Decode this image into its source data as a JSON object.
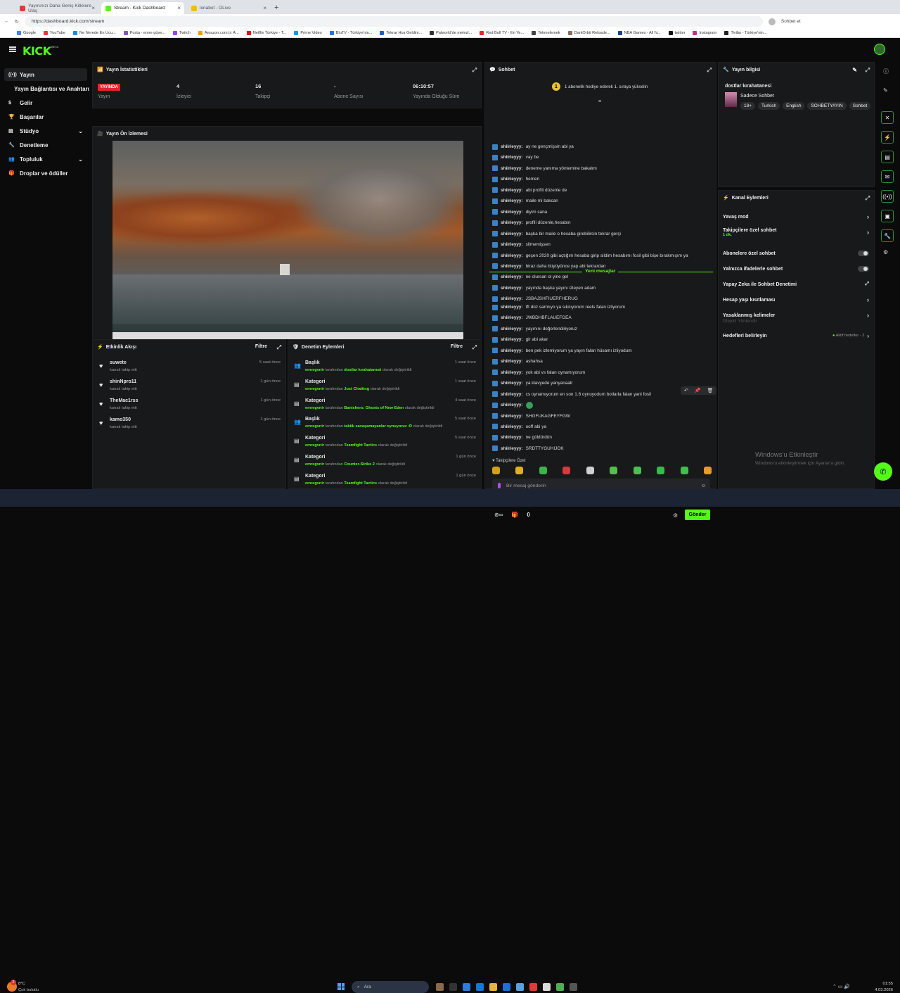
{
  "browser": {
    "tabs": [
      {
        "label": "Yayınınızı Daha Geniş Kitlelere Ulaş",
        "color": "#e53935"
      },
      {
        "label": "Stream - Kick Dashboard",
        "color": "#53fc18"
      },
      {
        "label": "lonabot - OLive",
        "color": "#f0c000"
      }
    ],
    "url": "https://dashboard.kick.com/stream",
    "right_label": "Sohbet et",
    "bookmarks": [
      "Google",
      "YouTube",
      "Ne Nerede En Ucu...",
      "Posta - emre güve...",
      "Twitch",
      "Amazon.com.tr: A...",
      "Netflix Türkiye - T...",
      "Prime Video",
      "BluTV - Türkiye'nin...",
      "Tekrar Hoş Geldini...",
      "Palworld'de melezl...",
      "Red Bull TV - En Ye...",
      "Tekmelemek",
      "DarkOrbit Reloade...",
      "NBA Games - All N...",
      "twitter",
      "Instagram",
      "Tivibu - Türkiye'nin..."
    ]
  },
  "nav": {
    "logo": "KICK",
    "beta": "BETA"
  },
  "sidebar": {
    "items": [
      "Yayın",
      "Yayın Bağlantısı ve Anahtarı",
      "Gelir",
      "Başarılar",
      "Stüdyo",
      "Denetleme",
      "Topluluk",
      "Droplar ve ödüller"
    ]
  },
  "stats": {
    "title": "Yayın İstatistikleri",
    "live_badge": "YAYINDA",
    "items": [
      {
        "value": "",
        "label": "Yayın"
      },
      {
        "value": "4",
        "label": "İzleyici"
      },
      {
        "value": "16",
        "label": "Takipçi"
      },
      {
        "value": "-",
        "label": "Abone Sayısı"
      },
      {
        "value": "06:10:57",
        "label": "Yayında Olduğu Süre"
      }
    ]
  },
  "preview": {
    "title": "Yayın Ön İzlemesi"
  },
  "activity": {
    "title": "Etkinlik Akışı",
    "filter": "Filtre",
    "items": [
      {
        "user": "suwete",
        "desc": "kanalı takip etti",
        "time": "5 saat önce"
      },
      {
        "user": "shinNpro11",
        "desc": "kanalı takip etti",
        "time": "1 gün önce"
      },
      {
        "user": "TheMac1rss",
        "desc": "kanalı takip etti",
        "time": "1 gün önce"
      },
      {
        "user": "kamo350",
        "desc": "kanalı takip etti",
        "time": "1 gün önce"
      }
    ]
  },
  "modlog": {
    "title": "Denetim Eylemleri",
    "filter": "Filtre",
    "items": [
      {
        "type": "Başlık",
        "user": "emregvnir",
        "pre": "tarafından",
        "value": "dostlar kırahatanesi",
        "post": "olarak değiştirildi",
        "time": "1 saat önce"
      },
      {
        "type": "Kategori",
        "user": "emregvnir",
        "pre": "tarafından",
        "value": "Just Chatting",
        "post": "olarak değiştirildi",
        "time": "1 saat önce"
      },
      {
        "type": "Kategori",
        "user": "emregvnir",
        "pre": "tarafından",
        "value": "Banishers: Ghosts of New Eden",
        "post": "olarak değiştirildi",
        "time": "4 saat önce"
      },
      {
        "type": "Başlık",
        "user": "emregvnir",
        "pre": "tarafından",
        "value": "taktik savaşamayanlar oynuyoruz :D",
        "post": "olarak değiştirildi",
        "time": "5 saat önce"
      },
      {
        "type": "Kategori",
        "user": "emregvnir",
        "pre": "tarafından",
        "value": "Teamfight Tactics",
        "post": "olarak değiştirildi",
        "time": "5 saat önce"
      },
      {
        "type": "Kategori",
        "user": "emregvnir",
        "pre": "tarafından",
        "value": "Counter-Strike 2",
        "post": "olarak değiştirildi",
        "time": "1 gün önce"
      },
      {
        "type": "Kategori",
        "user": "emregvnir",
        "pre": "tarafından",
        "value": "Teamfight Tactics",
        "post": "olarak değiştirildi",
        "time": "1 gün önce"
      }
    ]
  },
  "chat": {
    "title": "Sohbet",
    "gift_banner": "1 abonelik hediye ederek 1. sıraya yükselin",
    "gift_rank": "1",
    "user": "shiirieyyy:",
    "messages": [
      "ay ne gençmişsin abi ya",
      "vay be",
      "deneme yanıma yöntemine bakalım",
      "hemen",
      "abi profili düzenle de",
      "maile mi bakcan",
      "diyim sana",
      "profili düzenle,hesabın",
      "başka bir maile o hesaba girebilirsin tekrar gerçi",
      "silmemişsen",
      "geçen 2020 gibi açtığım hesaba girip sildim hesabımı fosil gibi bişe bırakmışım ya",
      "biraz daha büyüyünce yap abi tekrardan",
      "ne olursan ol yine gel",
      "yayında başka yayını izleyen adam",
      "JSBAJSHFIUERFHERUG"
    ],
    "new_label": "Yeni mesajlar",
    "new_messages": [
      "tft düz sarmıyo ya sıkılıyorum reels falan izliyorum",
      "JWBDHBFLAUEFGEA",
      "yayınını değerlendiriyoruz",
      "gir abi akar",
      "ben pek izlemiyorum ya yayın falan hüsamı izliyodum",
      "ashahsa",
      "yok abi vs falan oynamıyorum",
      "ya klavyede yanyanaalr",
      "cs oynamıyorum en son 1.6 oynuyodum botlarla falan yani fosil",
      "",
      "SHGFUKAGFEYFGW",
      "ooff abi ya",
      "ne güldürdün",
      "SRDTTYGUHIJOK"
    ],
    "followers_only": "Takipçilere Özel",
    "input_placeholder": "Bir mesaj gönderin",
    "count": "0",
    "send": "Gönder"
  },
  "info": {
    "title": "Yayın bilgisi",
    "stream_title": "dostlar kırahatanesi",
    "category": "Sadece Sohbet",
    "tags": [
      "18+",
      "Turkish",
      "English",
      "SOHBETYAYIN",
      "Sohbet"
    ]
  },
  "actions": {
    "title": "Kanal Eylemleri",
    "rows": [
      {
        "label": "Yavaş mod",
        "kind": "chevron"
      },
      {
        "label": "Takipçilere özel sohbet",
        "sub": "1 dk.",
        "kind": "chevron"
      },
      {
        "label": "Abonelere özel sohbet",
        "kind": "toggle"
      },
      {
        "label": "Yalnızca ifadelerle sohbet",
        "kind": "toggle"
      },
      {
        "label": "Yapay Zeka ile Sohbet Denetimi",
        "kind": "ext"
      },
      {
        "label": "Hesap yaşı kısıtlaması",
        "kind": "chevron"
      },
      {
        "label": "Yasaklanmış kelimeler",
        "kind": "chevron"
      }
    ],
    "viewer_redirect": "İzleyici Yönlendir",
    "targets": "Hedefleri belirleyin",
    "targets_status": "Aktif hedefler - 2"
  },
  "watermark": {
    "title": "Windows'u Etkinleştir",
    "sub": "Windows'u etkinleştirmek için Ayarlar'a gidin."
  },
  "taskbar": {
    "temp": "8°C",
    "weather": "Çok bulutlu",
    "search": "Ara",
    "time": "01:55",
    "date": "4.03.2026",
    "notif": "2"
  },
  "colors": {
    "accent": "#53fc18",
    "live": "#e2252c",
    "panel": "#18191b"
  }
}
